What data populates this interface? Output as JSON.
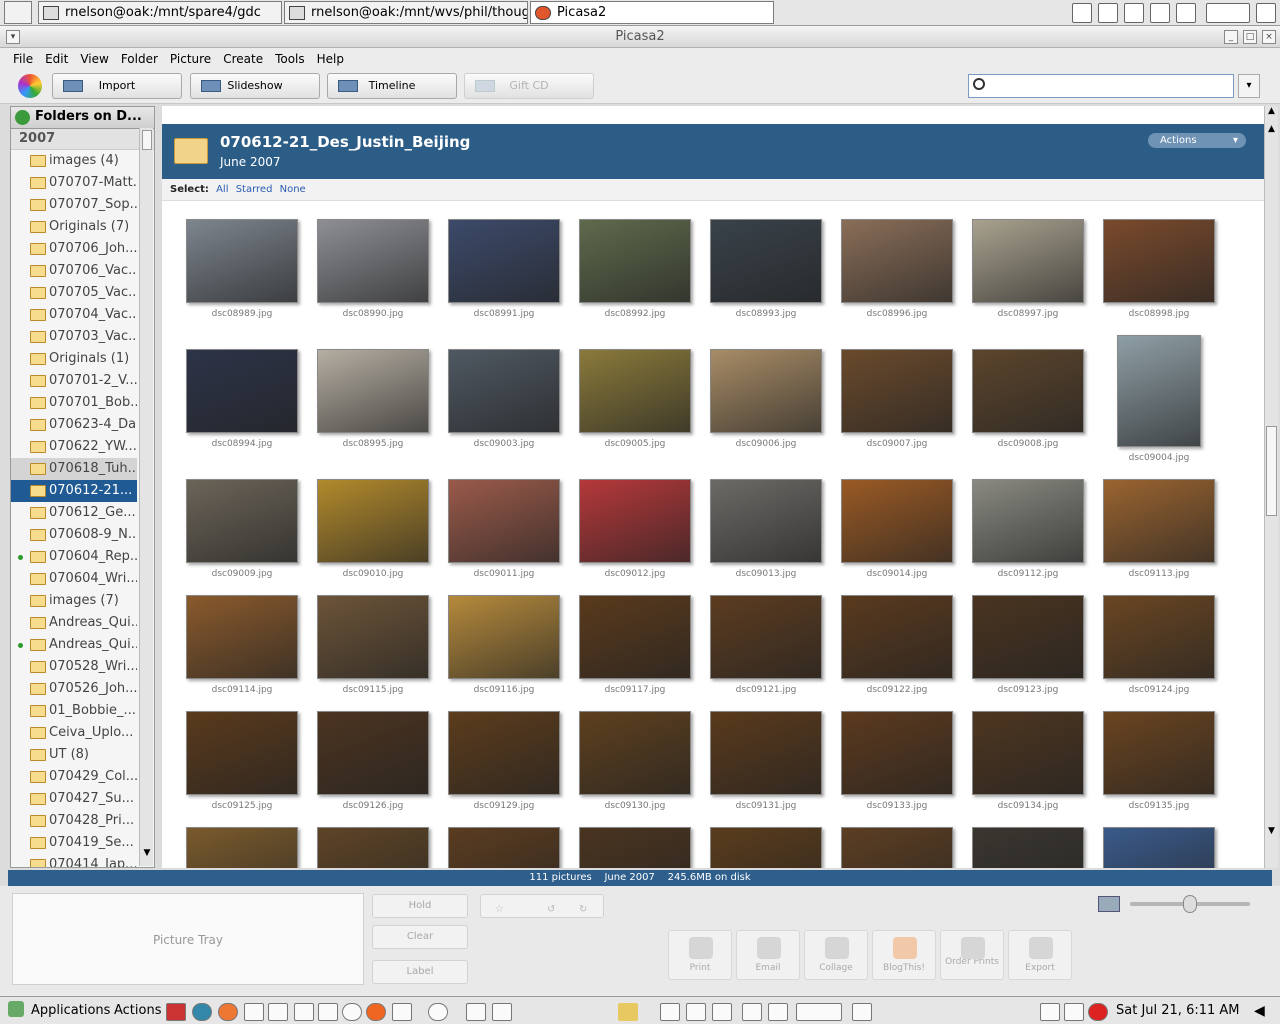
{
  "top_panel": {
    "tasks": [
      {
        "label": "rnelson@oak:/mnt/spare4/gdc"
      },
      {
        "label": "rnelson@oak:/mnt/wvs/phil/thoughtlet"
      },
      {
        "label": "Picasa2"
      }
    ]
  },
  "window": {
    "title": "Picasa2"
  },
  "menu": [
    "File",
    "Edit",
    "View",
    "Folder",
    "Picture",
    "Create",
    "Tools",
    "Help"
  ],
  "toolbar": {
    "import": "Import",
    "slideshow": "Slideshow",
    "timeline": "Timeline",
    "giftcd": "Gift CD",
    "search_value": ""
  },
  "sidebar": {
    "header": "Folders on D...",
    "year": "2007",
    "items": [
      {
        "label": "images (4)"
      },
      {
        "label": "070707-Matt..."
      },
      {
        "label": "070707_Sop..."
      },
      {
        "label": "Originals (7)"
      },
      {
        "label": "070706_Joh..."
      },
      {
        "label": "070706_Vac..."
      },
      {
        "label": "070705_Vac..."
      },
      {
        "label": "070704_Vac..."
      },
      {
        "label": "070703_Vac..."
      },
      {
        "label": "Originals (1)"
      },
      {
        "label": "070701-2_V..."
      },
      {
        "label": "070701_Bob..."
      },
      {
        "label": "070623-4_Da..."
      },
      {
        "label": "070622_YW..."
      },
      {
        "label": "070618_Tuh..."
      },
      {
        "label": "070612-21..."
      },
      {
        "label": "070612_Ge..."
      },
      {
        "label": "070608-9_N..."
      },
      {
        "label": "070604_Rep..."
      },
      {
        "label": "070604_Wri..."
      },
      {
        "label": "images (7)"
      },
      {
        "label": "Andreas_Qui..."
      },
      {
        "label": "Andreas_Qui..."
      },
      {
        "label": "070528_Wri..."
      },
      {
        "label": "070526_Joh..."
      },
      {
        "label": "01_Bobbie_..."
      },
      {
        "label": "Ceiva_Uplo..."
      },
      {
        "label": "UT (8)"
      },
      {
        "label": "070429_Col..."
      },
      {
        "label": "070427_Su..."
      },
      {
        "label": "070428_Pri..."
      },
      {
        "label": "070419_Se..."
      },
      {
        "label": "070414_Jap..."
      }
    ]
  },
  "folder": {
    "title": "070612-21_Des_Justin_Beijing",
    "date": "June 2007",
    "actions": "Actions",
    "select_label": "Select:",
    "select_all": "All",
    "select_starred": "Starred",
    "select_none": "None"
  },
  "thumbs": [
    {
      "name": "dsc08989.jpg",
      "color": "#7d858e"
    },
    {
      "name": "dsc08990.jpg",
      "color": "#8d8f94"
    },
    {
      "name": "dsc08991.jpg",
      "color": "#3c4a6a"
    },
    {
      "name": "dsc08992.jpg",
      "color": "#5f6a4c"
    },
    {
      "name": "dsc08993.jpg",
      "color": "#39424a"
    },
    {
      "name": "dsc08996.jpg",
      "color": "#8a6e58"
    },
    {
      "name": "dsc08997.jpg",
      "color": "#a9a28f"
    },
    {
      "name": "dsc08998.jpg",
      "color": "#7a4a2c"
    },
    {
      "name": "dsc08994.jpg",
      "color": "#2d3448"
    },
    {
      "name": "dsc08995.jpg",
      "color": "#b5aea2"
    },
    {
      "name": "dsc09003.jpg",
      "color": "#4f5862"
    },
    {
      "name": "dsc09005.jpg",
      "color": "#8a7a3a"
    },
    {
      "name": "dsc09006.jpg",
      "color": "#a88c66"
    },
    {
      "name": "dsc09007.jpg",
      "color": "#6a4a2c"
    },
    {
      "name": "dsc09008.jpg",
      "color": "#5c452c"
    },
    {
      "name": "dsc09004.jpg",
      "color": "#8f9fa6"
    },
    {
      "name": "dsc09009.jpg",
      "color": "#6b6458"
    },
    {
      "name": "dsc09010.jpg",
      "color": "#b28a2c"
    },
    {
      "name": "dsc09011.jpg",
      "color": "#9a5a4a"
    },
    {
      "name": "dsc09012.jpg",
      "color": "#b5383a"
    },
    {
      "name": "dsc09013.jpg",
      "color": "#6c6a66"
    },
    {
      "name": "dsc09014.jpg",
      "color": "#9a5a24"
    },
    {
      "name": "dsc09112.jpg",
      "color": "#8a8a82"
    },
    {
      "name": "dsc09113.jpg",
      "color": "#9a6430"
    },
    {
      "name": "dsc09114.jpg",
      "color": "#8a5a2c"
    },
    {
      "name": "dsc09115.jpg",
      "color": "#6c5438"
    },
    {
      "name": "dsc09116.jpg",
      "color": "#b58a3c"
    },
    {
      "name": "dsc09117.jpg",
      "color": "#5a3a1c"
    },
    {
      "name": "dsc09121.jpg",
      "color": "#5c3c20"
    },
    {
      "name": "dsc09122.jpg",
      "color": "#5a3a1e"
    },
    {
      "name": "dsc09123.jpg",
      "color": "#4a3420"
    },
    {
      "name": "dsc09124.jpg",
      "color": "#6a4622"
    },
    {
      "name": "dsc09125.jpg",
      "color": "#5a3a1c"
    },
    {
      "name": "dsc09126.jpg",
      "color": "#4c3420"
    },
    {
      "name": "dsc09129.jpg",
      "color": "#5c3c1c"
    },
    {
      "name": "dsc09130.jpg",
      "color": "#5e401e"
    },
    {
      "name": "dsc09131.jpg",
      "color": "#5a3a1c"
    },
    {
      "name": "dsc09133.jpg",
      "color": "#5c3a1e"
    },
    {
      "name": "dsc09134.jpg",
      "color": "#4e3620"
    },
    {
      "name": "dsc09135.jpg",
      "color": "#6a4420"
    },
    {
      "name": "",
      "color": "#7a5a2c"
    },
    {
      "name": "",
      "color": "#5e4426"
    },
    {
      "name": "",
      "color": "#5a3c20"
    },
    {
      "name": "",
      "color": "#4a3420"
    },
    {
      "name": "",
      "color": "#5a3c1c"
    },
    {
      "name": "",
      "color": "#5c3e22"
    },
    {
      "name": "",
      "color": "#3a3630"
    },
    {
      "name": "",
      "color": "#3a5a8a"
    }
  ],
  "status": {
    "count": "111 pictures",
    "date": "June 2007",
    "size": "245.6MB on disk"
  },
  "bottom": {
    "picture_tray": "Picture Tray",
    "hold": "Hold",
    "clear": "Clear",
    "label": "Label",
    "print": "Print",
    "email": "Email",
    "collage": "Collage",
    "blogthis": "BlogThis!",
    "order_prints": "Order Prints",
    "export": "Export"
  },
  "bottom_panel": {
    "applications": "Applications",
    "actions": "Actions",
    "clock": "Sat Jul 21,  6:11 AM"
  }
}
